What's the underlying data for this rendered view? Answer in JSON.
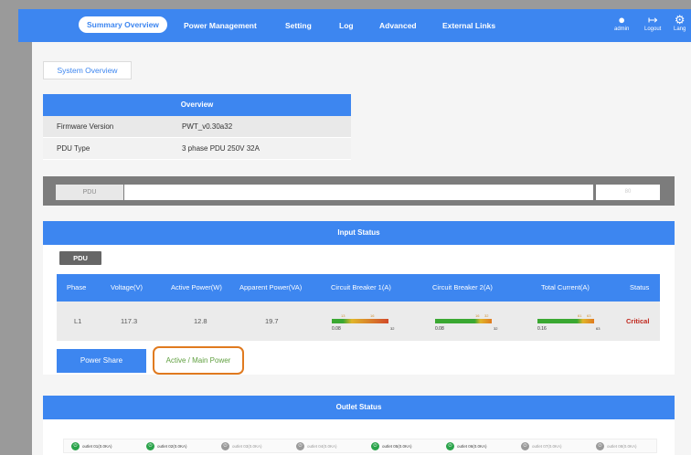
{
  "nav": {
    "items": [
      "Summary Overview",
      "Power Management",
      "Setting",
      "Log",
      "Advanced",
      "External Links"
    ],
    "active": "Summary Overview",
    "user_label": "admin",
    "logout_label": "Logout",
    "language_label": "Lang"
  },
  "tab": {
    "system_overview": "System Overview"
  },
  "overview": {
    "title": "Overview",
    "rows": [
      {
        "key": "Firmware Version",
        "value": "PWT_v0.30a32"
      },
      {
        "key": "PDU Type",
        "value": "3 phase PDU 250V 32A"
      }
    ]
  },
  "pdu_bar": {
    "tag": "PDU",
    "end_label": "80"
  },
  "input_status": {
    "title": "Input Status",
    "pdu_label": "PDU",
    "columns": [
      "Phase",
      "Voltage(V)",
      "Active Power(W)",
      "Apparent Power(VA)",
      "Circuit Breaker 1(A)",
      "Circuit Breaker 2(A)",
      "Total Current(A)",
      "Status"
    ],
    "row": {
      "phase": "L1",
      "voltage": "117.3",
      "active_power": "12.8",
      "apparent_power": "19.7",
      "cb1": "0.08",
      "cb2": "0.08",
      "total_current": "0.16",
      "status": "Critical"
    },
    "gauge_ticks": {
      "cb1": [
        "13",
        "16",
        "32"
      ],
      "cb2": [
        "16",
        "32",
        "32"
      ],
      "total": [
        "61",
        "63",
        "63"
      ]
    },
    "status_color": "#c0271c",
    "buttons": {
      "power_share": "Power Share",
      "active_main": "Active / Main Power"
    }
  },
  "outlet_status": {
    "title": "Outlet Status",
    "outlets": [
      {
        "name": "outlet 01(0.0KA)",
        "on": true
      },
      {
        "name": "outlet 02(0.0KA)",
        "on": true
      },
      {
        "name": "outlet 03(0.0KA)",
        "on": false
      },
      {
        "name": "outlet 04(0.0KA)",
        "on": false
      },
      {
        "name": "outlet 05(0.0KA)",
        "on": true
      },
      {
        "name": "outlet 06(0.0KA)",
        "on": true
      },
      {
        "name": "outlet 07(0.0KA)",
        "on": false
      },
      {
        "name": "outlet 08(0.0KA)",
        "on": false
      }
    ]
  },
  "colors": {
    "accent": "#3d86f0",
    "warning_outline": "#e07a1f",
    "on": "#2aa34a",
    "off": "#9a9a9a"
  }
}
